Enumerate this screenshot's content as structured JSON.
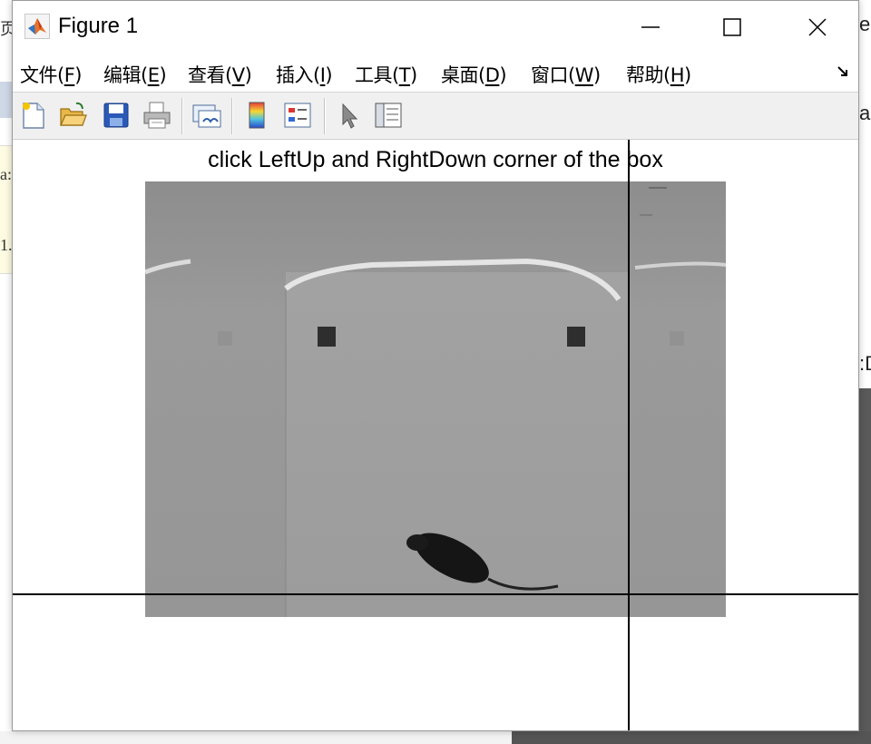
{
  "background": {
    "left_chars": [
      "页",
      "a:",
      "1."
    ],
    "right_chars": [
      "e",
      "a",
      ":D"
    ]
  },
  "window": {
    "title": "Figure 1",
    "controls": [
      "minimize",
      "maximize",
      "close"
    ]
  },
  "menu": {
    "items": [
      {
        "text": "文件(",
        "key": "F",
        "close": ")"
      },
      {
        "text": "编辑(",
        "key": "E",
        "close": ")"
      },
      {
        "text": "查看(",
        "key": "V",
        "close": ")"
      },
      {
        "text": "插入(",
        "key": "I",
        "close": ")"
      },
      {
        "text": "工具(",
        "key": "T",
        "close": ")"
      },
      {
        "text": "桌面(",
        "key": "D",
        "close": ")"
      },
      {
        "text": "窗口(",
        "key": "W",
        "close": ")"
      },
      {
        "text": "帮助(",
        "key": "H",
        "close": ")"
      }
    ],
    "dock_icon": "dock-arrow-icon"
  },
  "toolbar": {
    "icons": [
      "new-figure-icon",
      "open-file-icon",
      "save-icon",
      "print-icon",
      "link-plot-icon",
      "insert-colorbar-icon",
      "insert-legend-icon",
      "edit-plot-cursor-icon",
      "property-inspector-icon"
    ]
  },
  "axes": {
    "title": "click LeftUp and RightDown corner of the box"
  },
  "colors": {
    "image_gray": "#8c8c8c",
    "crosshair": "#000000"
  }
}
